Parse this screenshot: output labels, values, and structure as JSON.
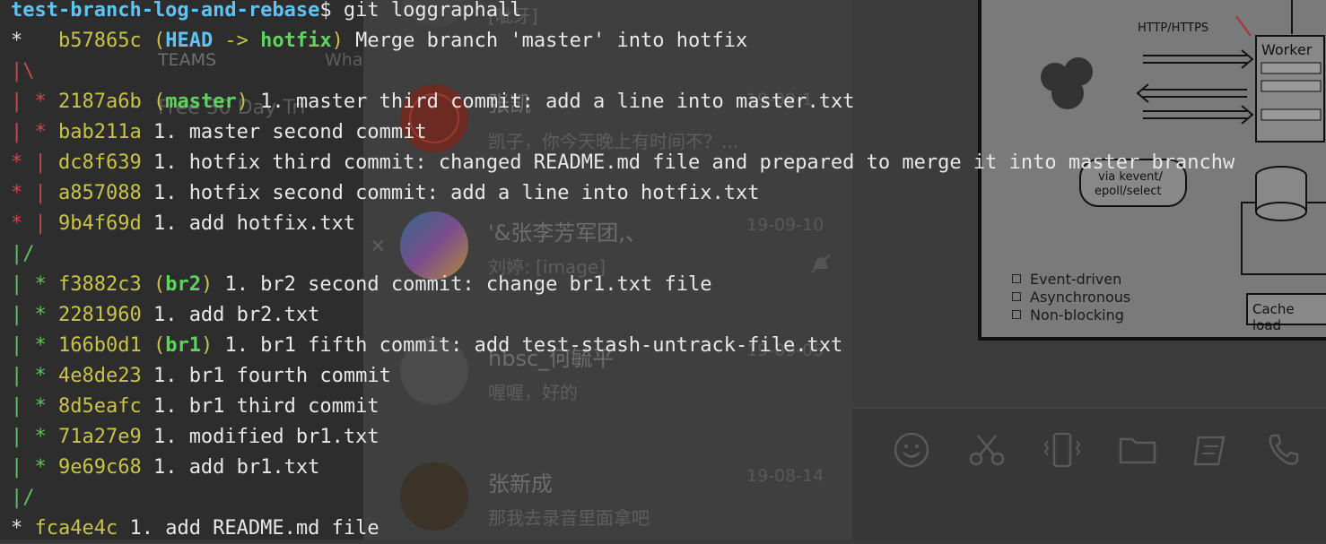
{
  "colors": {
    "prompt": "#5ec4f5",
    "hash": "#c9c34a",
    "graph_red": "#c74a4a",
    "graph_green": "#5ec25e",
    "ref": "#5fd35f",
    "text": "#e8e8e8"
  },
  "terminal": {
    "prompt_dir": "test-branch-log-and-rebase",
    "prompt_cmd": "$ git loggraphall",
    "lines": [
      {
        "graph": "*   ",
        "graph_color": "star",
        "hash": "b57865c",
        "head": "HEAD",
        "arrow": " -> ",
        "ref": "hotfix",
        "msg": " Merge branch 'master' into hotfix"
      },
      {
        "graph": "|\\",
        "graph_color": "red",
        "hash": "",
        "ref": "",
        "msg": ""
      },
      {
        "graph": "| * ",
        "graph_color": "red",
        "hash": "2187a6b",
        "ref": "master",
        "msg": " 1. master third commit: add a line into master.txt"
      },
      {
        "graph": "| * ",
        "graph_color": "red",
        "hash": "bab211a",
        "ref": "",
        "msg": "1. master second commit"
      },
      {
        "graph": "* | ",
        "graph_color": "red",
        "hash": "dc8f639",
        "ref": "",
        "msg": "1. hotfix third commit: changed README.md file and prepared to merge it into master branchw"
      },
      {
        "graph": "* | ",
        "graph_color": "red",
        "hash": "a857088",
        "ref": "",
        "msg": "1. hotfix second commit: add a line into hotfix.txt"
      },
      {
        "graph": "* | ",
        "graph_color": "red",
        "hash": "9b4f69d",
        "ref": "",
        "msg": "1. add hotfix.txt"
      },
      {
        "graph": "|/",
        "graph_color": "green",
        "hash": "",
        "ref": "",
        "msg": ""
      },
      {
        "graph": "| * ",
        "graph_color": "green",
        "hash": "f3882c3",
        "ref": "br2",
        "msg": " 1. br2 second commit: change br1.txt file"
      },
      {
        "graph": "| * ",
        "graph_color": "green",
        "hash": "2281960",
        "ref": "",
        "msg": "1. add br2.txt"
      },
      {
        "graph": "| * ",
        "graph_color": "green",
        "hash": "166b0d1",
        "ref": "br1",
        "msg": " 1. br1 fifth commit: add test-stash-untrack-file.txt"
      },
      {
        "graph": "| * ",
        "graph_color": "green",
        "hash": "4e8de23",
        "ref": "",
        "msg": "1. br1 fourth commit"
      },
      {
        "graph": "| * ",
        "graph_color": "green",
        "hash": "8d5eafc",
        "ref": "",
        "msg": "1. br1 third commit"
      },
      {
        "graph": "| * ",
        "graph_color": "green",
        "hash": "71a27e9",
        "ref": "",
        "msg": "1. modified br1.txt"
      },
      {
        "graph": "| * ",
        "graph_color": "green",
        "hash": "9e69c68",
        "ref": "",
        "msg": "1. add br1.txt"
      },
      {
        "graph": "|/",
        "graph_color": "green",
        "hash": "",
        "ref": "",
        "msg": ""
      },
      {
        "graph": "* ",
        "graph_color": "star",
        "hash": "fca4e4c",
        "ref": "",
        "msg": "1. add README.md file"
      }
    ]
  },
  "background": {
    "teams_label": "TEAMS",
    "wha_label": "Wha",
    "trial_label": "Free 30 Day Tri",
    "close_glyph": "×",
    "top_preview": "[呲牙]",
    "chats": [
      {
        "name": "张凯",
        "preview": "凯子，你今天晚上有时间不？...",
        "date": "19-09-1"
      },
      {
        "name": "'&张李芳军团,、",
        "preview": "刘婷: [image]",
        "date": "19-09-10"
      },
      {
        "name": "hbsc_何毓平",
        "preview": "喔喔，好的",
        "date": "19-09-05"
      },
      {
        "name": "张新成",
        "preview": "那我去录音里面拿吧",
        "date": "19-08-14"
      }
    ],
    "diagram": {
      "http_label": "HTTP/HTTPS",
      "worker_label": "Worker",
      "kevent_label": "via kevent/",
      "epoll_label": "epoll/select",
      "cache_label": "Cache load",
      "legend": [
        "Event-driven",
        "Asynchronous",
        "Non-blocking"
      ]
    },
    "toolbar_icons": [
      "emoji-icon",
      "scissors-icon",
      "phone-shake-icon",
      "folder-icon",
      "note-icon",
      "phone-call-icon"
    ]
  }
}
